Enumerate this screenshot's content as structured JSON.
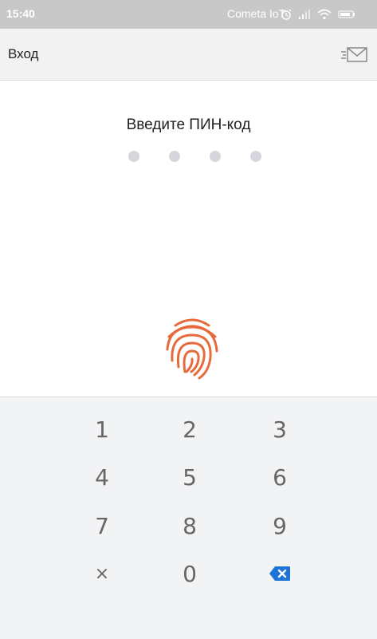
{
  "status_bar": {
    "time": "15:40",
    "carrier": "Cometa IoT",
    "icons": [
      "alarm-icon",
      "signal-icon",
      "wifi-icon",
      "battery-icon"
    ]
  },
  "header": {
    "title": "Вход",
    "action_icon": "mail-icon"
  },
  "pin": {
    "title": "Введите ПИН-код",
    "entered_digits": 0,
    "length": 4
  },
  "fingerprint": {
    "icon": "fingerprint-icon",
    "color": "#e8693c"
  },
  "keypad": {
    "keys": [
      "1",
      "2",
      "3",
      "4",
      "5",
      "6",
      "7",
      "8",
      "9",
      "×",
      "0"
    ],
    "backspace_icon": "backspace-icon",
    "accent": "#1e73d6"
  },
  "colors": {
    "status_bar": "#c8c8c8",
    "app_bar": "#f2f2f2",
    "keypad_bg": "#f2f3f5",
    "dot": "#d6d7dc"
  }
}
